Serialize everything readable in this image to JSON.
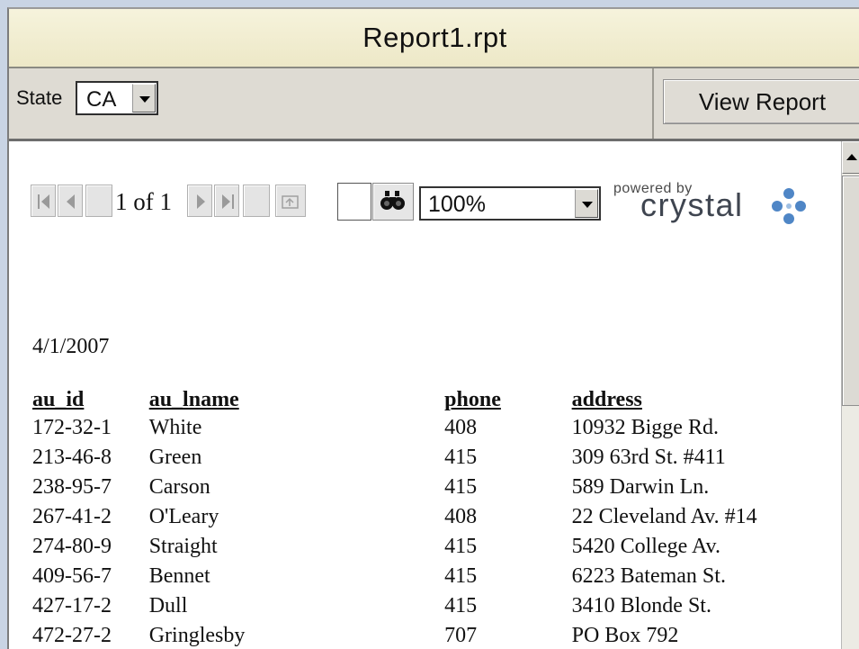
{
  "window": {
    "title": "Report1.rpt"
  },
  "params": {
    "state_label": "State",
    "state_value": "CA",
    "view_button": "View Report"
  },
  "toolbar": {
    "page_indicator": "1 of 1",
    "zoom_value": "100%",
    "search_value": "",
    "brand_powered": "powered by",
    "brand_name": "crystal"
  },
  "report": {
    "date": "4/1/2007",
    "columns": [
      "au_id",
      "au_lname",
      "phone",
      "address"
    ],
    "rows": [
      [
        "172-32-1",
        "White",
        "408",
        "10932 Bigge Rd."
      ],
      [
        "213-46-8",
        "Green",
        "415",
        "309 63rd St. #411"
      ],
      [
        "238-95-7",
        "Carson",
        "415",
        "589 Darwin Ln."
      ],
      [
        "267-41-2",
        "O'Leary",
        "408",
        "22 Cleveland Av. #14"
      ],
      [
        "274-80-9",
        "Straight",
        "415",
        "5420 College Av."
      ],
      [
        "409-56-7",
        "Bennet",
        "415",
        "6223 Bateman St."
      ],
      [
        "427-17-2",
        "Dull",
        "415",
        "3410 Blonde St."
      ],
      [
        "472-27-2",
        "Gringlesby",
        "707",
        "PO Box 792"
      ]
    ]
  },
  "colors": {
    "background": "#c9d4e4",
    "titlebar": "#f3f0d6",
    "params_bar": "#dedbd3",
    "brand_dots": "#4f86c6"
  },
  "icons": [
    "first-page-icon",
    "prev-page-icon",
    "next-page-icon",
    "last-page-icon",
    "group-tree-icon",
    "binoculars-icon",
    "dropdown-arrow-icon",
    "crystal-logo-icon"
  ]
}
